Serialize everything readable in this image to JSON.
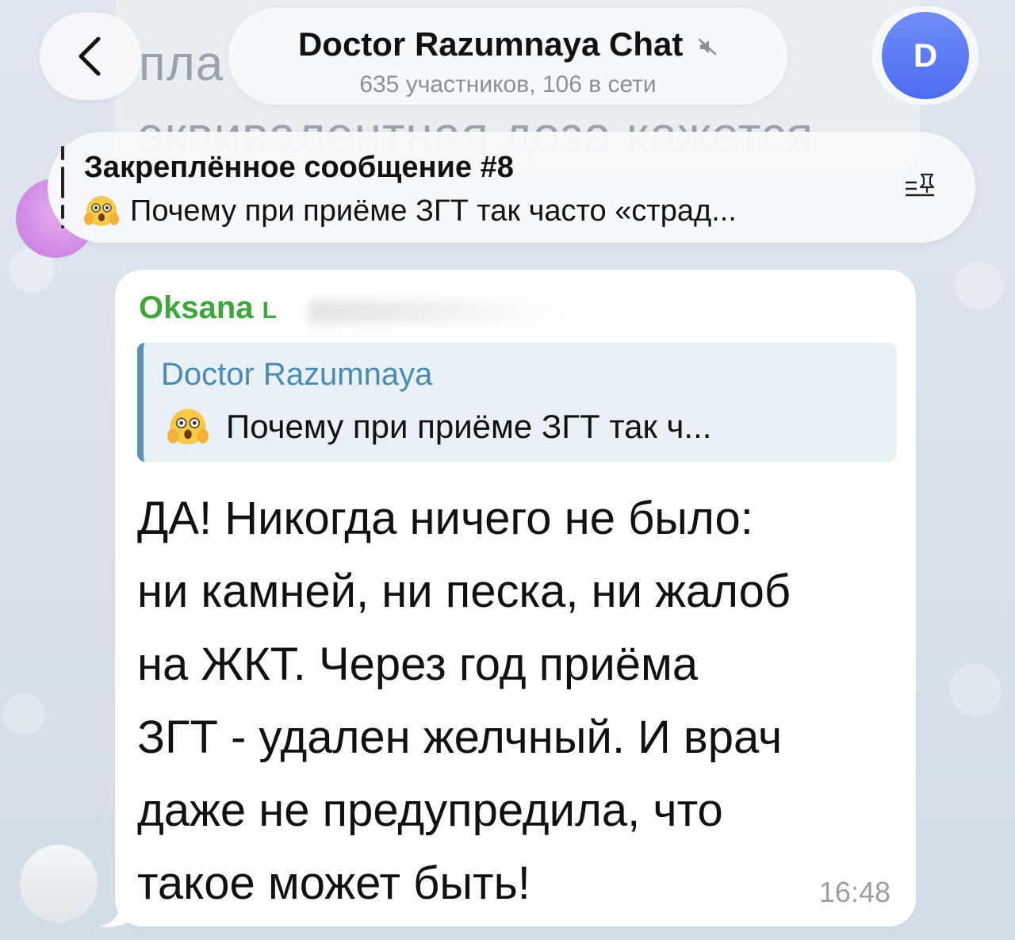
{
  "header": {
    "chat_title": "Doctor Razumnaya Chat",
    "chat_subtitle": "635 участников, 106 в сети",
    "avatar_letter": "D",
    "back_icon": "chevron-left-icon",
    "mute_icon": "muted-speaker-icon"
  },
  "background_message": {
    "line_1": "пла",
    "line_2": "эквивалентная доза кажется"
  },
  "pinned": {
    "title": "Закреплённое сообщение #8",
    "preview_text": "Почему при приёме ЗГТ так часто «страд...",
    "emoji": "shocked-face-emoji",
    "list_icon": "pinned-list-icon"
  },
  "message": {
    "sender": "Oksana",
    "sender_initial": "L",
    "reply": {
      "author": "Doctor Razumnaya",
      "text": "Почему при приёме ЗГТ так ч...",
      "emoji": "shocked-face-emoji"
    },
    "text": "ДА! Никогда ничего не было:\nни камней, ни песка, ни жалоб\nна ЖКТ. Через год приёма\nЗГТ - удален желчный. И врач\nдаже не предупредила, что\nтакое может быть!",
    "time": "16:48"
  },
  "colors": {
    "sender": "#3fa63b",
    "reply_author": "#4c8ab0",
    "reply_bar": "#5a93b5",
    "avatar": "#5a77f2",
    "background": "#d9e2ec"
  }
}
